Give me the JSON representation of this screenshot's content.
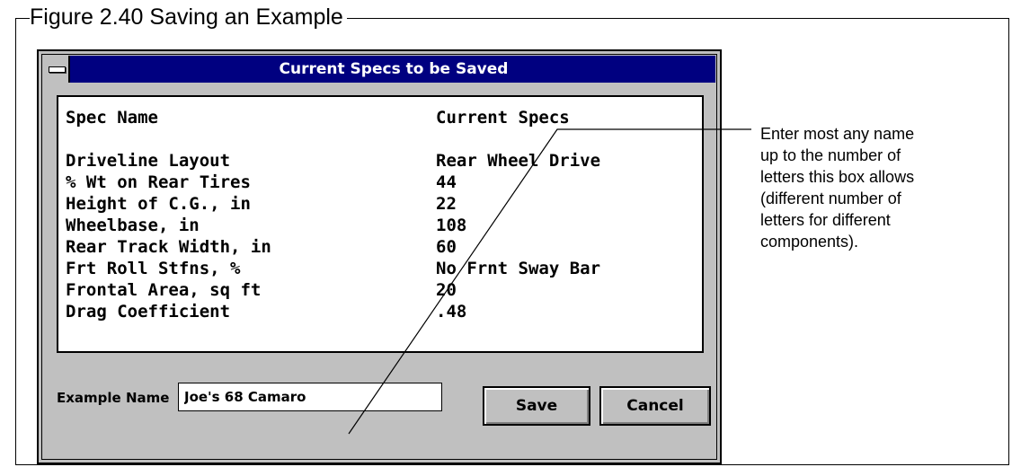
{
  "figure": {
    "title": "Figure 2.40  Saving an Example"
  },
  "window": {
    "title": "Current Specs to be Saved"
  },
  "list": {
    "header": {
      "name": "Spec Name",
      "value": "Current Specs"
    },
    "rows": [
      {
        "name": "Driveline Layout",
        "value": "Rear Wheel Drive"
      },
      {
        "name": "% Wt on Rear Tires",
        "value": "44"
      },
      {
        "name": "Height of C.G., in",
        "value": "22"
      },
      {
        "name": "Wheelbase, in",
        "value": "108"
      },
      {
        "name": "Rear Track Width, in",
        "value": "60"
      },
      {
        "name": "Frt Roll Stfns, %",
        "value": "No Frnt Sway Bar"
      },
      {
        "name": "Frontal Area, sq ft",
        "value": "20"
      },
      {
        "name": "Drag Coefficient",
        "value": ".48"
      }
    ]
  },
  "form": {
    "example_name_label": "Example Name",
    "example_name_value": "Joe's 68 Camaro",
    "save_label": "Save",
    "cancel_label": "Cancel"
  },
  "annotation": {
    "lines": [
      "Enter most any name",
      "up to the number of",
      "letters this box allows",
      "(different number of",
      "letters for different",
      "components)."
    ]
  },
  "icons": {
    "system_menu": "system-menu-icon"
  }
}
